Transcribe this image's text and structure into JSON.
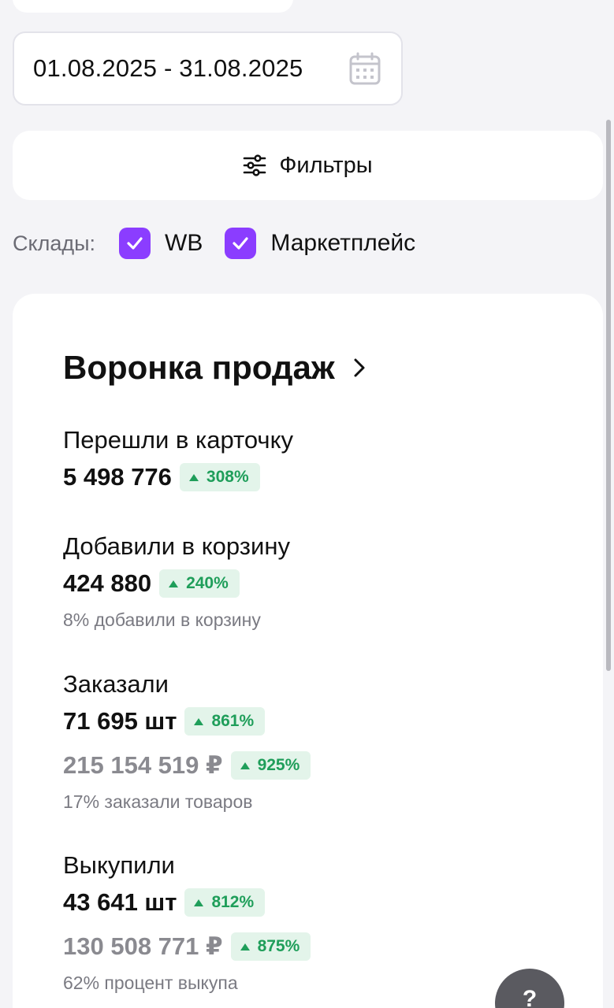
{
  "date_range": {
    "value": "01.08.2025 - 31.08.2025"
  },
  "filters": {
    "label": "Фильтры"
  },
  "warehouses": {
    "label": "Склады:",
    "options": [
      {
        "label": "WB",
        "checked": true
      },
      {
        "label": "Маркетплейс",
        "checked": true
      }
    ]
  },
  "funnel": {
    "title": "Воронка продаж",
    "metrics": [
      {
        "label": "Перешли в карточку",
        "value": "5 498 776",
        "change": "308%"
      },
      {
        "label": "Добавили в корзину",
        "value": "424 880",
        "change": "240%",
        "note": "8% добавили в корзину"
      },
      {
        "label": "Заказали",
        "value": "71 695 шт",
        "change": "861%",
        "money": "215 154 519 ₽",
        "money_change": "925%",
        "note": "17% заказали товаров"
      },
      {
        "label": "Выкупили",
        "value": "43 641 шт",
        "change": "812%",
        "money": "130 508 771 ₽",
        "money_change": "875%",
        "note": "62% процент выкупа"
      }
    ]
  },
  "help": {
    "label": "?"
  },
  "colors": {
    "accent": "#8b3dff",
    "positive": "#1f9e5a",
    "positive_bg": "#e3f4ea"
  }
}
